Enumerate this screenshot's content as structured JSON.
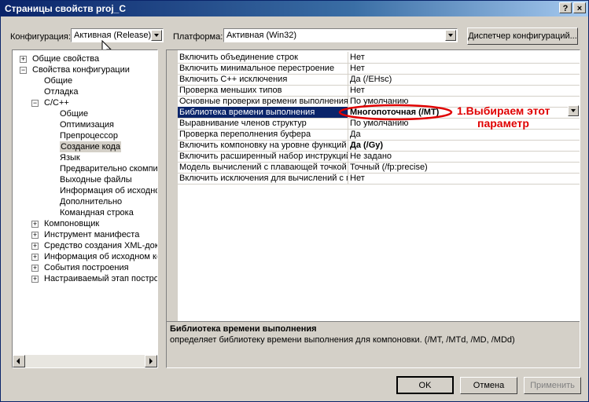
{
  "window": {
    "title": "Страницы свойств proj_C",
    "help_label": "?",
    "close_label": "×"
  },
  "config": {
    "label": "Конфигурация:",
    "value": "Активная (Release)"
  },
  "platform": {
    "label": "Платформа:",
    "value": "Активная (Win32)"
  },
  "config_manager_label": "Диспетчер конфигураций...",
  "tree": [
    {
      "label": "Общие свойства",
      "level": 0,
      "expander": "+"
    },
    {
      "label": "Свойства конфигурации",
      "level": 0,
      "expander": "−"
    },
    {
      "label": "Общие",
      "level": 1,
      "expander": ""
    },
    {
      "label": "Отладка",
      "level": 1,
      "expander": ""
    },
    {
      "label": "C/C++",
      "level": 1,
      "expander": "−"
    },
    {
      "label": "Общие",
      "level": 2,
      "expander": ""
    },
    {
      "label": "Оптимизация",
      "level": 2,
      "expander": ""
    },
    {
      "label": "Препроцессор",
      "level": 2,
      "expander": ""
    },
    {
      "label": "Создание кода",
      "level": 2,
      "expander": "",
      "selected": true
    },
    {
      "label": "Язык",
      "level": 2,
      "expander": ""
    },
    {
      "label": "Предварительно скомпилир",
      "level": 2,
      "expander": ""
    },
    {
      "label": "Выходные файлы",
      "level": 2,
      "expander": ""
    },
    {
      "label": "Информация об исходном к",
      "level": 2,
      "expander": ""
    },
    {
      "label": "Дополнительно",
      "level": 2,
      "expander": ""
    },
    {
      "label": "Командная строка",
      "level": 2,
      "expander": ""
    },
    {
      "label": "Компоновщик",
      "level": 1,
      "expander": "+"
    },
    {
      "label": "Инструмент манифеста",
      "level": 1,
      "expander": "+"
    },
    {
      "label": "Средство создания XML-докумен",
      "level": 1,
      "expander": "+"
    },
    {
      "label": "Информация об исходном коде",
      "level": 1,
      "expander": "+"
    },
    {
      "label": "События построения",
      "level": 1,
      "expander": "+"
    },
    {
      "label": "Настраиваемый этап построени",
      "level": 1,
      "expander": "+"
    }
  ],
  "properties": [
    {
      "name": "Включить объединение строк",
      "value": "Нет"
    },
    {
      "name": "Включить минимальное перестроение",
      "value": "Нет"
    },
    {
      "name": "Включить C++ исключения",
      "value": "Да (/EHsc)"
    },
    {
      "name": "Проверка меньших типов",
      "value": "Нет"
    },
    {
      "name": "Основные проверки времени выполнения",
      "value": "По умолчанию"
    },
    {
      "name": "Библиотека времени выполнения",
      "value": "Многопоточная (/MT)",
      "selected": true,
      "bold": true
    },
    {
      "name": "Выравнивание членов структур",
      "value": "По умолчанию"
    },
    {
      "name": "Проверка переполнения буфера",
      "value": "Да"
    },
    {
      "name": "Включить компоновку на уровне функций",
      "value": "Да (/Gy)",
      "bold": true
    },
    {
      "name": "Включить расширенный набор инструкций",
      "value": "Не задано"
    },
    {
      "name": "Модель вычислений с плавающей точкой",
      "value": "Точный (/fp:precise)"
    },
    {
      "name": "Включить исключения для вычислений с плаваю",
      "value": "Нет"
    }
  ],
  "annotation": {
    "line1": "1.Выбираем этот",
    "line2": "параметр",
    "color": "#e00000"
  },
  "description": {
    "title": "Библиотека времени выполнения",
    "text": "определяет библиотеку времени выполнения для компоновки. (/MT, /MTd, /MD, /MDd)"
  },
  "buttons": {
    "ok": "OK",
    "cancel": "Отмена",
    "apply": "Применить"
  }
}
